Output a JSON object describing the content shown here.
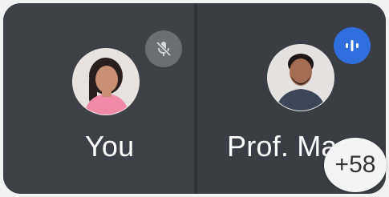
{
  "participants": [
    {
      "name": "You",
      "audio": "muted",
      "icon": "mic-off-icon"
    },
    {
      "name": "Prof. Manish",
      "display_name": "Prof. Ma",
      "audio": "speaking",
      "icon": "audio-wave-icon"
    }
  ],
  "overflow": {
    "label": "+58"
  },
  "colors": {
    "tile_bg": "#3d4047",
    "mute_badge": "#6b6e75",
    "speaking_badge": "#2f6fde",
    "text": "#ffffff"
  }
}
